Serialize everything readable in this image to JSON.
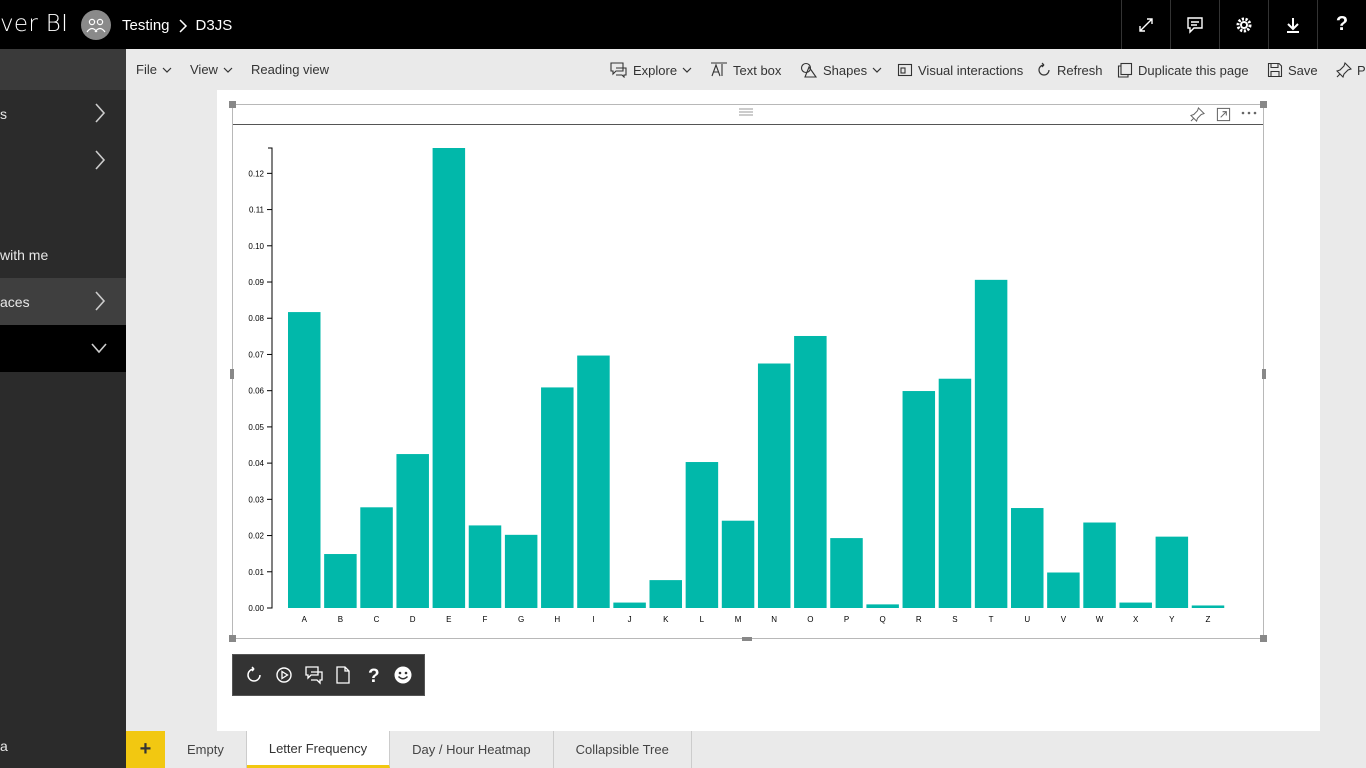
{
  "topbar": {
    "app_title": "ver BI",
    "breadcrumb": [
      "Testing",
      "D3JS"
    ],
    "icons": [
      "expand-icon",
      "comment-icon",
      "gear-icon",
      "download-icon",
      "help-icon"
    ]
  },
  "sidebar": {
    "items": [
      {
        "label": "s",
        "chevron": "right"
      },
      {
        "label": "",
        "chevron": "right"
      },
      {
        "label": "with me",
        "chevron": ""
      },
      {
        "label": "aces",
        "chevron": "right"
      },
      {
        "label": "",
        "chevron": "down"
      }
    ],
    "bottom_label": "a"
  },
  "ribbon": {
    "file": "File",
    "view": "View",
    "reading_view": "Reading view",
    "explore": "Explore",
    "text_box": "Text box",
    "shapes": "Shapes",
    "visual_interactions": "Visual interactions",
    "refresh": "Refresh",
    "duplicate": "Duplicate this page",
    "save": "Save",
    "pin": "P"
  },
  "chart_data": {
    "type": "bar",
    "title": "",
    "xlabel": "",
    "ylabel": "",
    "categories": [
      "A",
      "B",
      "C",
      "D",
      "E",
      "F",
      "G",
      "H",
      "I",
      "J",
      "K",
      "L",
      "M",
      "N",
      "O",
      "P",
      "Q",
      "R",
      "S",
      "T",
      "U",
      "V",
      "W",
      "X",
      "Y",
      "Z"
    ],
    "values": [
      0.0817,
      0.0149,
      0.0278,
      0.0425,
      0.127,
      0.0228,
      0.0202,
      0.0609,
      0.0697,
      0.0015,
      0.0077,
      0.0403,
      0.0241,
      0.0675,
      0.0751,
      0.0193,
      0.001,
      0.0599,
      0.0633,
      0.0906,
      0.0276,
      0.0098,
      0.0236,
      0.0015,
      0.0197,
      0.0007
    ],
    "yticks": [
      "0.00",
      "0.01",
      "0.02",
      "0.03",
      "0.04",
      "0.05",
      "0.06",
      "0.07",
      "0.08",
      "0.09",
      "0.10",
      "0.11",
      "0.12"
    ],
    "ylim": [
      0,
      0.127
    ],
    "bar_color": "#01b8aa"
  },
  "tabs": {
    "add": "+",
    "pages": [
      "Empty",
      "Letter Frequency",
      "Day / Hour Heatmap",
      "Collapsible Tree"
    ],
    "active_index": 1
  },
  "colors": {
    "accent": "#f2c811",
    "topbar": "#000000",
    "sidebar": "#2b2b2b"
  }
}
